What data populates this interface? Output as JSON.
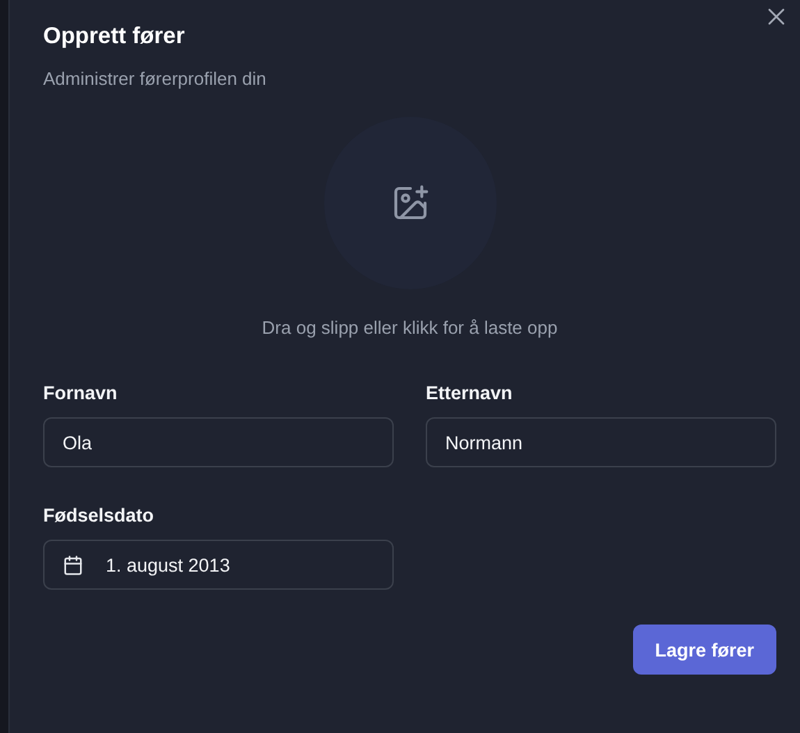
{
  "dialog": {
    "title": "Opprett fører",
    "description": "Administrer førerprofilen din"
  },
  "upload": {
    "hint": "Dra og slipp eller klikk for å laste opp"
  },
  "fields": [
    {
      "kind": "text",
      "label": "Fornavn",
      "value": "Ola"
    },
    {
      "kind": "text",
      "label": "Etternavn",
      "value": "Normann"
    },
    {
      "kind": "date",
      "label": "Fødselsdato",
      "value": "1. august 2013"
    }
  ],
  "submit": {
    "label": "Lagre fører"
  }
}
